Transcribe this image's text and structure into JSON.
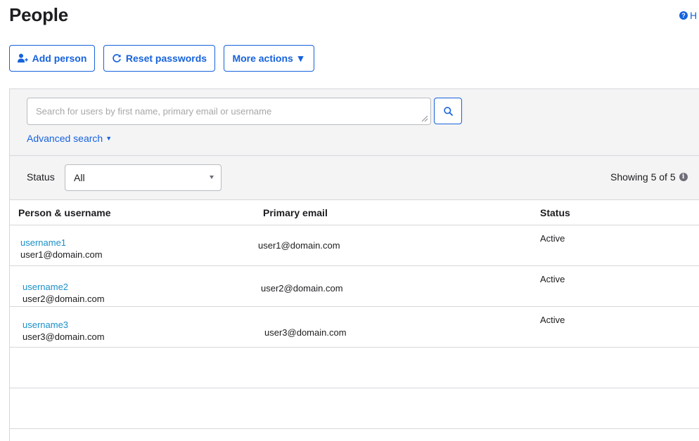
{
  "header": {
    "title": "People",
    "help_label": "H"
  },
  "toolbar": {
    "add_person_label": "Add person",
    "reset_passwords_label": "Reset passwords",
    "more_actions_label": "More actions ▼"
  },
  "search": {
    "placeholder": "Search for users by first name, primary email or username",
    "value": "",
    "advanced_label": "Advanced search",
    "advanced_caret": "▼"
  },
  "filter": {
    "status_label": "Status",
    "status_selected": "All",
    "showing_text": "Showing 5 of 5"
  },
  "table": {
    "columns": [
      "Person & username",
      "Primary email",
      "Status"
    ],
    "rows": [
      {
        "username": "username1",
        "person_email": "user1@domain.com",
        "primary_email": "user1@domain.com",
        "status": "Active"
      },
      {
        "username": "username2",
        "person_email": "user2@domain.com",
        "primary_email": "user2@domain.com",
        "status": "Active"
      },
      {
        "username": "username3",
        "person_email": "user3@domain.com",
        "primary_email": "user3@domain.com",
        "status": "Active"
      },
      {
        "username": "",
        "person_email": "",
        "primary_email": "",
        "status": ""
      },
      {
        "username": "",
        "person_email": "",
        "primary_email": "",
        "status": ""
      }
    ]
  },
  "icons": {
    "help": "help-circle-icon",
    "add_person": "add-user-icon",
    "reset": "refresh-icon",
    "search": "search-icon",
    "info": "info-icon"
  },
  "colors": {
    "accent": "#1662dd",
    "link": "#1a8fc9",
    "panel_bg": "#f4f4f5",
    "border": "#d7d7dc"
  }
}
